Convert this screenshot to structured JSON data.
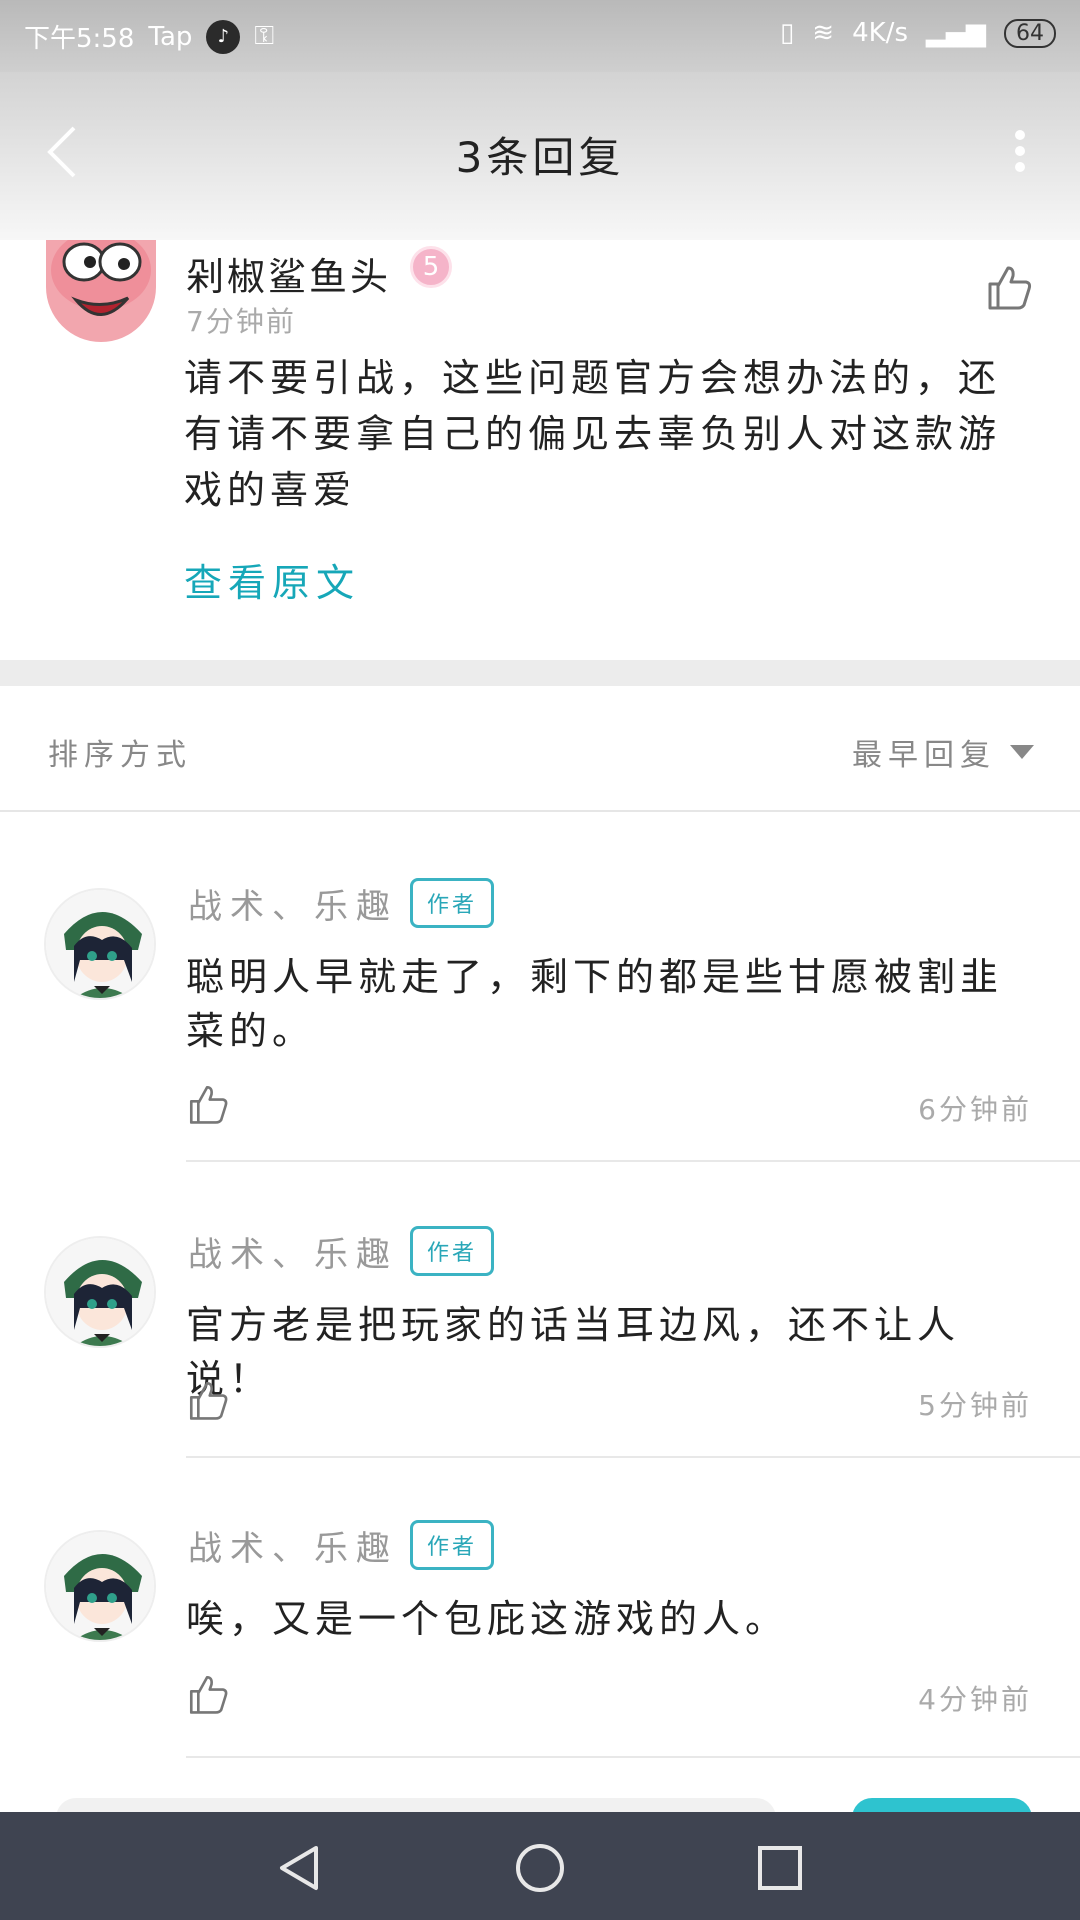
{
  "status_bar": {
    "time": "下午5:58",
    "app_label": "Tap",
    "network_speed": "4K/s",
    "battery": "64"
  },
  "header": {
    "title": "3条回复"
  },
  "original_comment": {
    "author": "剁椒鲨鱼头",
    "level": "5",
    "time": "7分钟前",
    "content": "请不要引战，这些问题官方会想办法的，还有请不要拿自己的偏见去辜负别人对这款游戏的喜爱",
    "view_original_label": "查看原文"
  },
  "sort": {
    "label": "排序方式",
    "selected": "最早回复"
  },
  "replies": [
    {
      "author": "战术、乐趣",
      "tag": "作者",
      "text": "聪明人早就走了，剩下的都是些甘愿被割韭菜的。",
      "time": "6分钟前"
    },
    {
      "author": "战术、乐趣",
      "tag": "作者",
      "text": "官方老是把玩家的话当耳边风，还不让人说！",
      "time": "5分钟前"
    },
    {
      "author": "战术、乐趣",
      "tag": "作者",
      "text": "唉，又是一个包庇这游戏的人。",
      "time": "4分钟前"
    }
  ],
  "colors": {
    "accent": "#16a7b8",
    "nav_background": "#3f4451"
  }
}
